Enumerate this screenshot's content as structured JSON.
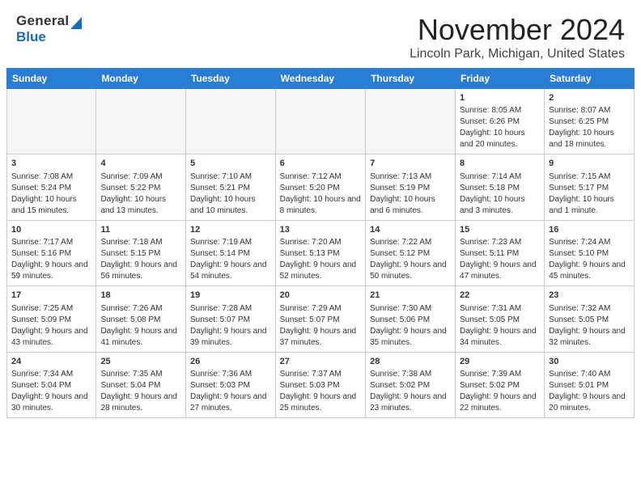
{
  "header": {
    "logo_general": "General",
    "logo_blue": "Blue",
    "month_title": "November 2024",
    "location": "Lincoln Park, Michigan, United States"
  },
  "calendar": {
    "days_of_week": [
      "Sunday",
      "Monday",
      "Tuesday",
      "Wednesday",
      "Thursday",
      "Friday",
      "Saturday"
    ],
    "weeks": [
      [
        {
          "day": "",
          "empty": true
        },
        {
          "day": "",
          "empty": true
        },
        {
          "day": "",
          "empty": true
        },
        {
          "day": "",
          "empty": true
        },
        {
          "day": "",
          "empty": true
        },
        {
          "day": "1",
          "sunrise": "8:05 AM",
          "sunset": "6:26 PM",
          "daylight": "10 hours and 20 minutes."
        },
        {
          "day": "2",
          "sunrise": "8:07 AM",
          "sunset": "6:25 PM",
          "daylight": "10 hours and 18 minutes."
        }
      ],
      [
        {
          "day": "3",
          "sunrise": "7:08 AM",
          "sunset": "5:24 PM",
          "daylight": "10 hours and 15 minutes."
        },
        {
          "day": "4",
          "sunrise": "7:09 AM",
          "sunset": "5:22 PM",
          "daylight": "10 hours and 13 minutes."
        },
        {
          "day": "5",
          "sunrise": "7:10 AM",
          "sunset": "5:21 PM",
          "daylight": "10 hours and 10 minutes."
        },
        {
          "day": "6",
          "sunrise": "7:12 AM",
          "sunset": "5:20 PM",
          "daylight": "10 hours and 8 minutes."
        },
        {
          "day": "7",
          "sunrise": "7:13 AM",
          "sunset": "5:19 PM",
          "daylight": "10 hours and 6 minutes."
        },
        {
          "day": "8",
          "sunrise": "7:14 AM",
          "sunset": "5:18 PM",
          "daylight": "10 hours and 3 minutes."
        },
        {
          "day": "9",
          "sunrise": "7:15 AM",
          "sunset": "5:17 PM",
          "daylight": "10 hours and 1 minute."
        }
      ],
      [
        {
          "day": "10",
          "sunrise": "7:17 AM",
          "sunset": "5:16 PM",
          "daylight": "9 hours and 59 minutes."
        },
        {
          "day": "11",
          "sunrise": "7:18 AM",
          "sunset": "5:15 PM",
          "daylight": "9 hours and 56 minutes."
        },
        {
          "day": "12",
          "sunrise": "7:19 AM",
          "sunset": "5:14 PM",
          "daylight": "9 hours and 54 minutes."
        },
        {
          "day": "13",
          "sunrise": "7:20 AM",
          "sunset": "5:13 PM",
          "daylight": "9 hours and 52 minutes."
        },
        {
          "day": "14",
          "sunrise": "7:22 AM",
          "sunset": "5:12 PM",
          "daylight": "9 hours and 50 minutes."
        },
        {
          "day": "15",
          "sunrise": "7:23 AM",
          "sunset": "5:11 PM",
          "daylight": "9 hours and 47 minutes."
        },
        {
          "day": "16",
          "sunrise": "7:24 AM",
          "sunset": "5:10 PM",
          "daylight": "9 hours and 45 minutes."
        }
      ],
      [
        {
          "day": "17",
          "sunrise": "7:25 AM",
          "sunset": "5:09 PM",
          "daylight": "9 hours and 43 minutes."
        },
        {
          "day": "18",
          "sunrise": "7:26 AM",
          "sunset": "5:08 PM",
          "daylight": "9 hours and 41 minutes."
        },
        {
          "day": "19",
          "sunrise": "7:28 AM",
          "sunset": "5:07 PM",
          "daylight": "9 hours and 39 minutes."
        },
        {
          "day": "20",
          "sunrise": "7:29 AM",
          "sunset": "5:07 PM",
          "daylight": "9 hours and 37 minutes."
        },
        {
          "day": "21",
          "sunrise": "7:30 AM",
          "sunset": "5:06 PM",
          "daylight": "9 hours and 35 minutes."
        },
        {
          "day": "22",
          "sunrise": "7:31 AM",
          "sunset": "5:05 PM",
          "daylight": "9 hours and 34 minutes."
        },
        {
          "day": "23",
          "sunrise": "7:32 AM",
          "sunset": "5:05 PM",
          "daylight": "9 hours and 32 minutes."
        }
      ],
      [
        {
          "day": "24",
          "sunrise": "7:34 AM",
          "sunset": "5:04 PM",
          "daylight": "9 hours and 30 minutes."
        },
        {
          "day": "25",
          "sunrise": "7:35 AM",
          "sunset": "5:04 PM",
          "daylight": "9 hours and 28 minutes."
        },
        {
          "day": "26",
          "sunrise": "7:36 AM",
          "sunset": "5:03 PM",
          "daylight": "9 hours and 27 minutes."
        },
        {
          "day": "27",
          "sunrise": "7:37 AM",
          "sunset": "5:03 PM",
          "daylight": "9 hours and 25 minutes."
        },
        {
          "day": "28",
          "sunrise": "7:38 AM",
          "sunset": "5:02 PM",
          "daylight": "9 hours and 23 minutes."
        },
        {
          "day": "29",
          "sunrise": "7:39 AM",
          "sunset": "5:02 PM",
          "daylight": "9 hours and 22 minutes."
        },
        {
          "day": "30",
          "sunrise": "7:40 AM",
          "sunset": "5:01 PM",
          "daylight": "9 hours and 20 minutes."
        }
      ]
    ]
  }
}
